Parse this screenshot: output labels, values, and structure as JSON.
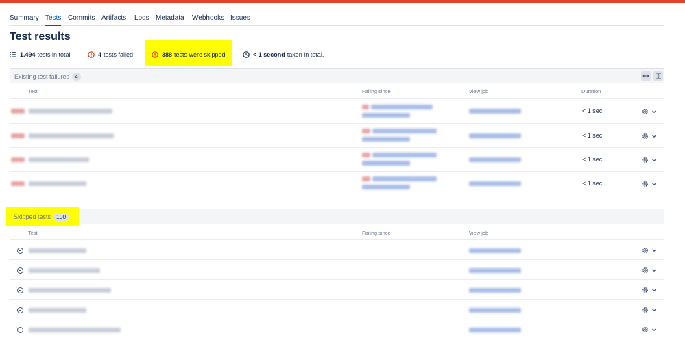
{
  "tabs": [
    "Summary",
    "Tests",
    "Commits",
    "Artifacts",
    "Logs",
    "Metadata",
    "Webhooks",
    "Issues"
  ],
  "active_tab": "Tests",
  "page_title": "Test results",
  "summary": {
    "total_count": "1.494",
    "total_label": "tests in total",
    "failed_count": "4",
    "failed_label": "tests failed",
    "skipped_count": "388",
    "skipped_label": "tests were skipped",
    "duration_value": "< 1 second",
    "duration_label": "taken in total."
  },
  "failures_section": {
    "title": "Existing test failures",
    "count": "4",
    "columns": {
      "test": "Test",
      "failing_since": "Failing since",
      "view_job": "View job",
      "duration": "Duration"
    },
    "rows": [
      {
        "duration": "< 1 sec"
      },
      {
        "duration": "< 1 sec"
      },
      {
        "duration": "< 1 sec"
      },
      {
        "duration": "< 1 sec"
      }
    ]
  },
  "skipped_section": {
    "title": "Skipped tests",
    "count": "100",
    "columns": {
      "test": "Test",
      "failing_since": "Failing since",
      "view_job": "View job"
    }
  },
  "icons": {
    "summary_total": "list-icon",
    "summary_failed": "error-icon",
    "summary_skipped": "error-icon",
    "summary_duration": "clock-icon",
    "row_action": "gear-icon",
    "row_action_menu": "chevron-down-icon",
    "skipped_row": "skip-icon"
  },
  "colors": {
    "accent": "#0052cc",
    "brand_bar": "#e8412a",
    "error": "#de350b",
    "highlight": "#ffff00"
  }
}
